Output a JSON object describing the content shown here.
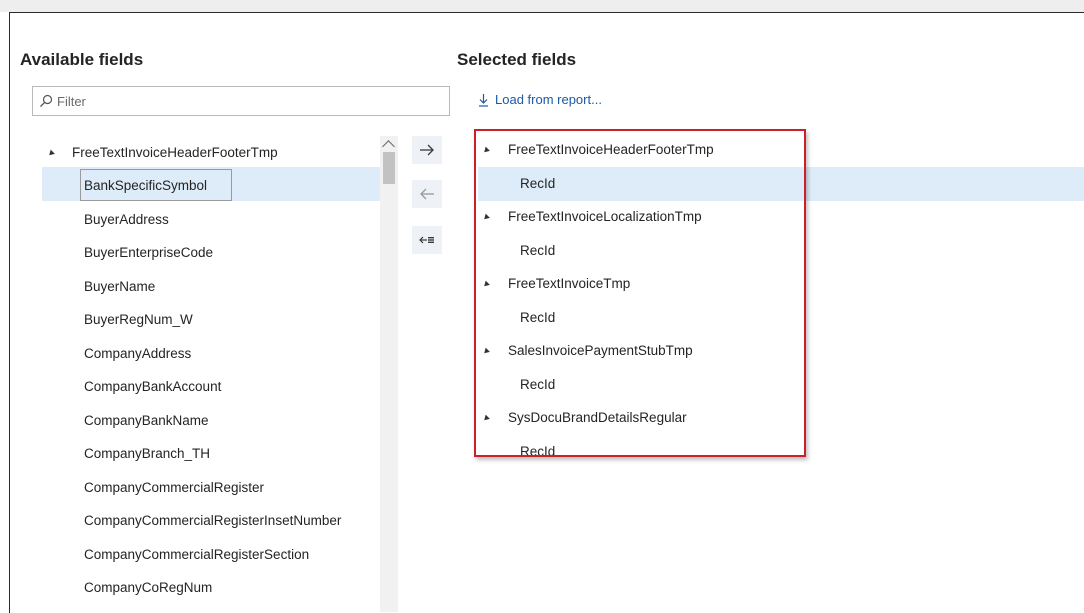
{
  "available": {
    "heading": "Available fields",
    "filter_placeholder": "Filter",
    "group": "FreeTextInvoiceHeaderFooterTmp",
    "items": [
      "BankSpecificSymbol",
      "BuyerAddress",
      "BuyerEnterpriseCode",
      "BuyerName",
      "BuyerRegNum_W",
      "CompanyAddress",
      "CompanyBankAccount",
      "CompanyBankName",
      "CompanyBranch_TH",
      "CompanyCommercialRegister",
      "CompanyCommercialRegisterInsetNumber",
      "CompanyCommercialRegisterSection",
      "CompanyCoRegNum"
    ]
  },
  "move_buttons": {
    "add_icon": "arrow-right-icon",
    "remove_icon": "arrow-left-icon",
    "remove_all_icon": "remove-all-icon"
  },
  "selected": {
    "heading": "Selected fields",
    "load_link": "Load from report...",
    "groups": [
      {
        "name": "FreeTextInvoiceHeaderFooterTmp",
        "field": "RecId"
      },
      {
        "name": "FreeTextInvoiceLocalizationTmp",
        "field": "RecId"
      },
      {
        "name": "FreeTextInvoiceTmp",
        "field": "RecId"
      },
      {
        "name": "SalesInvoicePaymentStubTmp",
        "field": "RecId"
      },
      {
        "name": "SysDocuBrandDetailsRegular",
        "field": "RecId"
      }
    ]
  },
  "colors": {
    "accent": "#1a5aa6",
    "selection": "#deecf9",
    "highlight_box": "#c9202a"
  }
}
